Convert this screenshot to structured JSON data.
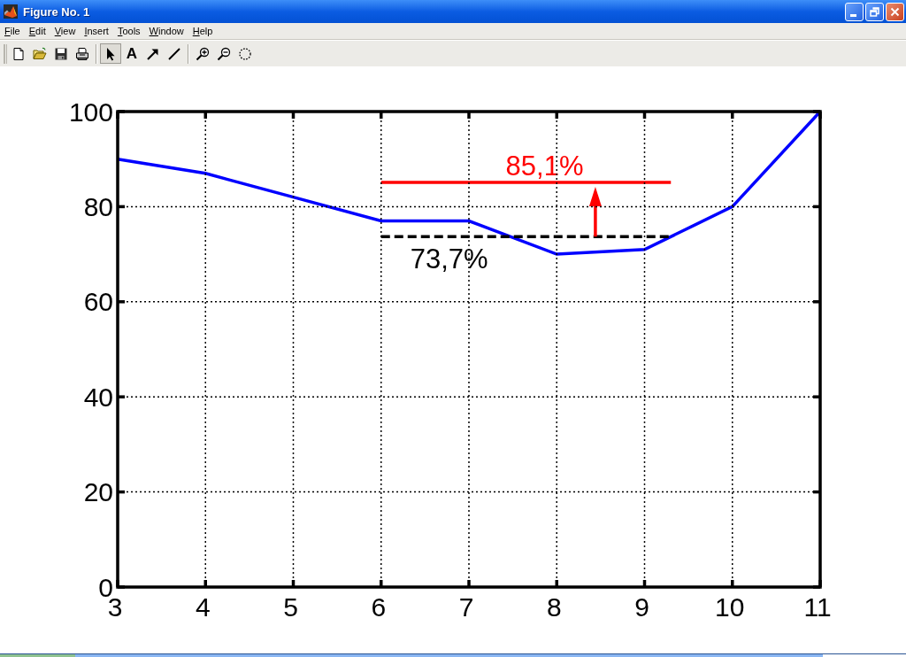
{
  "window": {
    "title": "Figure No. 1"
  },
  "menu": [
    "File",
    "Edit",
    "View",
    "Insert",
    "Tools",
    "Window",
    "Help"
  ],
  "toolbar": {
    "toggles": [
      {
        "selected": true
      },
      {
        "label": "A",
        "selected": false
      },
      {
        "selected": false
      },
      {
        "selected": false
      },
      {
        "selected": false
      },
      {
        "selected": false
      },
      {
        "selected": false
      }
    ]
  },
  "figure": {
    "chart_data": {
      "type": "line",
      "x": [
        3,
        4,
        5,
        6,
        7,
        8,
        9,
        10,
        11
      ],
      "series": [
        {
          "color": "#0000ff",
          "values": [
            90,
            87,
            82,
            77,
            77,
            70,
            71,
            80,
            100
          ]
        }
      ],
      "xlim": [
        3,
        11
      ],
      "ylim": [
        0,
        100
      ],
      "xticks": [
        3,
        4,
        5,
        6,
        7,
        8,
        9,
        10,
        11
      ],
      "yticks": [
        0,
        20,
        40,
        60,
        80,
        100
      ],
      "grid": true,
      "ref_lines": [
        {
          "axis": "y",
          "value": 85.1,
          "color": "#ff0000",
          "label": "85,1%"
        },
        {
          "axis": "y",
          "value": 73.7,
          "color": "#000000",
          "label": "73,7%"
        }
      ]
    }
  }
}
